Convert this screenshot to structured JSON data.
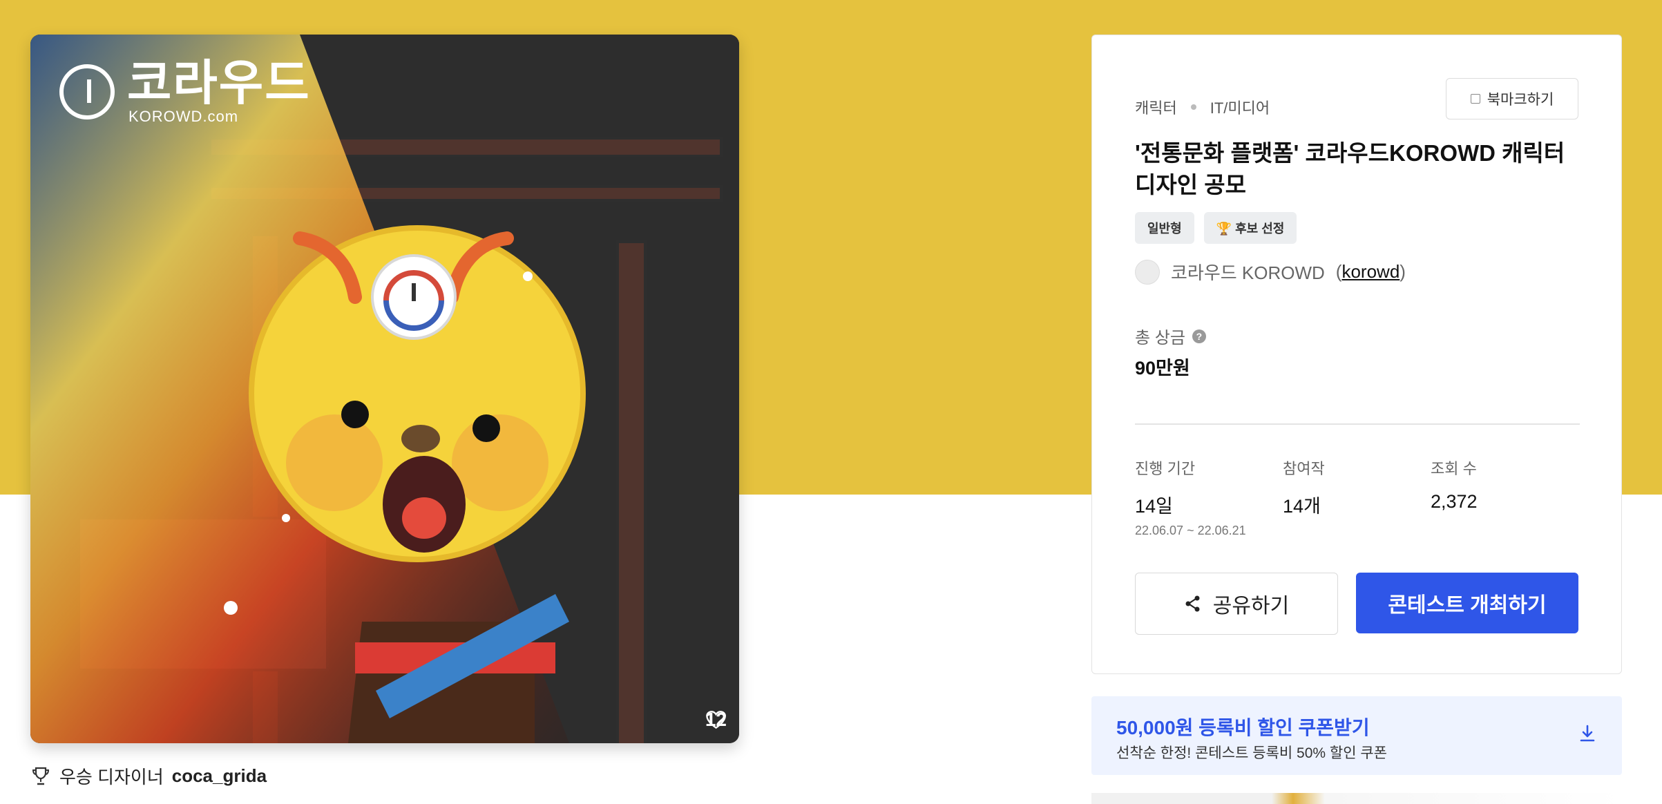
{
  "hero": {
    "logo_text": "코라우드",
    "logo_url": "KOROWD.com",
    "like_count": "12"
  },
  "winner": {
    "label": "우승 디자이너",
    "name": "coca_grida"
  },
  "contest": {
    "category": "캐릭터",
    "tag": "IT/미디어",
    "bookmark_label": "북마크하기",
    "title": "'전통문화 플랫폼' 코라우드KOROWD 캐릭터 디자인 공모",
    "badges": [
      "일반형",
      "🏆 후보 선정"
    ],
    "host_name": "코라우드 KOROWD",
    "host_id": "korowd",
    "prize_label": "총 상금",
    "prize_value": "90만원",
    "stats": [
      {
        "label": "진행 기간",
        "value": "14일",
        "sub": "22.06.07 ~ 22.06.21"
      },
      {
        "label": "참여작",
        "value": "14개"
      },
      {
        "label": "조회 수",
        "value": "2,372"
      }
    ],
    "share_label": "공유하기",
    "host_button_label": "콘테스트 개최하기"
  },
  "coupon": {
    "title": "50,000원 등록비 할인 쿠폰받기",
    "subtitle": "선착순 한정! 콘테스트 등록비 50% 할인 쿠폰"
  },
  "icons": {
    "heart": "heart-icon",
    "trophy": "trophy-icon",
    "share": "share-icon",
    "download": "download-icon"
  },
  "colors": {
    "band": "#e5c23e",
    "primary": "#2f56e8"
  }
}
